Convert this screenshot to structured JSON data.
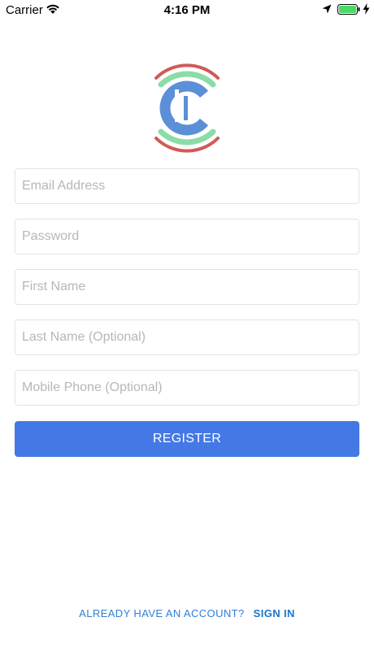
{
  "status_bar": {
    "carrier": "Carrier",
    "time": "4:16 PM",
    "icons": [
      "wifi-icon",
      "location-arrow-icon",
      "battery-icon",
      "charging-bolt-icon"
    ],
    "battery_color": "#4cd964"
  },
  "logo": {
    "icon": "broadcast-c-logo",
    "colors": {
      "outer_arc": "#d05a57",
      "inner_arc": "#8bdca6",
      "letter": "#5b8fd8"
    }
  },
  "form": {
    "email_placeholder": "Email Address",
    "password_placeholder": "Password",
    "first_name_placeholder": "First Name",
    "last_name_placeholder": "Last Name (Optional)",
    "mobile_phone_placeholder": "Mobile Phone (Optional)",
    "email_value": "",
    "password_value": "",
    "first_name_value": "",
    "last_name_value": "",
    "mobile_phone_value": ""
  },
  "register_label": "REGISTER",
  "footer": {
    "prompt": "ALREADY HAVE AN ACCOUNT?",
    "sign_in_label": "SIGN IN"
  },
  "colors": {
    "primary": "#4479e5",
    "link": "#2f7fd8"
  }
}
